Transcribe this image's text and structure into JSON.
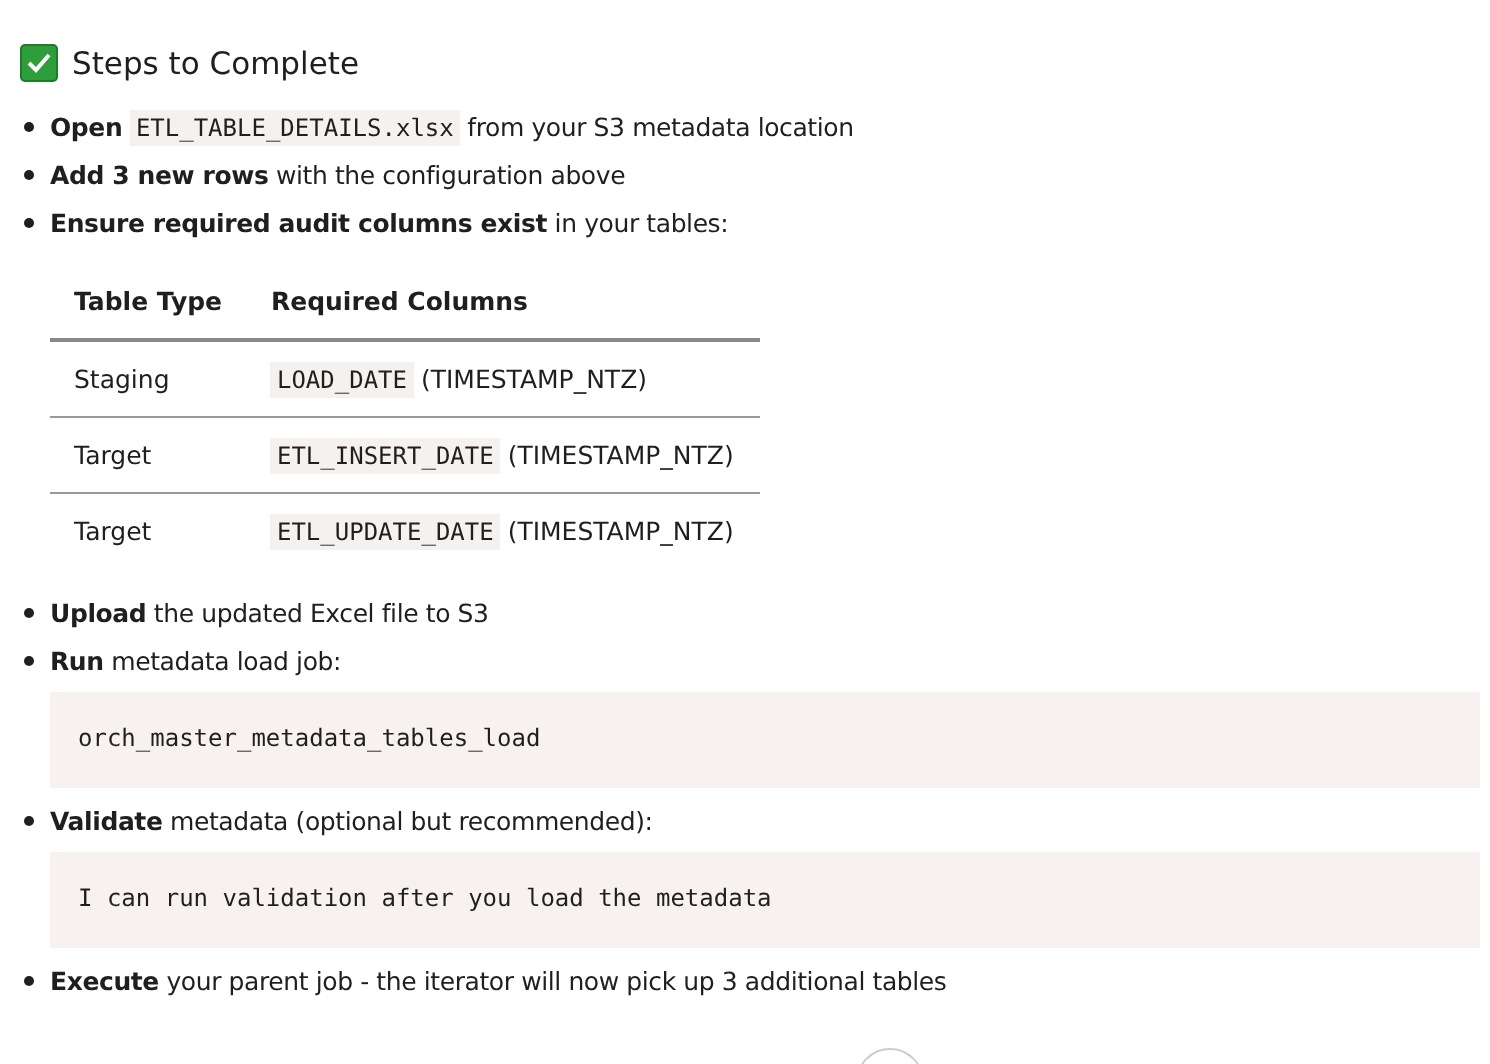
{
  "heading": {
    "title": "Steps to Complete"
  },
  "blocks": [
    {
      "kind": "bullet",
      "parts": [
        {
          "kind": "text",
          "text": "**Open** "
        },
        {
          "kind": "code",
          "text": "ETL_TABLE_DETAILS.xlsx"
        },
        {
          "kind": "text",
          "text": " from your S3 metadata location"
        }
      ]
    },
    {
      "kind": "bullet",
      "parts": [
        {
          "kind": "text",
          "text": "**Add 3 new rows** with the configuration above"
        }
      ]
    },
    {
      "kind": "bullet",
      "parts": [
        {
          "kind": "text",
          "text": "**Ensure required audit columns exist** in your tables:"
        }
      ]
    },
    {
      "kind": "table",
      "columns": [
        "Table Type",
        "Required Columns"
      ],
      "rows": [
        {
          "type": "Staging",
          "column": "LOAD_DATE",
          "datatype": " (TIMESTAMP_NTZ)"
        },
        {
          "type": "Target",
          "column": "ETL_INSERT_DATE",
          "datatype": " (TIMESTAMP_NTZ)"
        },
        {
          "type": "Target",
          "column": "ETL_UPDATE_DATE",
          "datatype": " (TIMESTAMP_NTZ)"
        }
      ]
    },
    {
      "kind": "bullet",
      "parts": [
        {
          "kind": "text",
          "text": "**Upload** the updated Excel file to S3"
        }
      ]
    },
    {
      "kind": "bullet",
      "parts": [
        {
          "kind": "text",
          "text": "**Run** metadata load job:"
        }
      ]
    },
    {
      "kind": "code",
      "text": "orch_master_metadata_tables_load"
    },
    {
      "kind": "bullet",
      "parts": [
        {
          "kind": "text",
          "text": "**Validate** metadata (optional but recommended):"
        }
      ]
    },
    {
      "kind": "code",
      "text": "I can run validation after you load the metadata"
    },
    {
      "kind": "bullet",
      "parts": [
        {
          "kind": "text",
          "text": "**Execute** your parent job - the iterator will now pick up 3 additional tables"
        }
      ]
    }
  ]
}
